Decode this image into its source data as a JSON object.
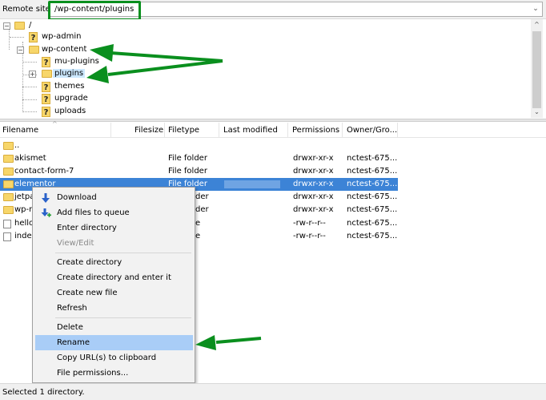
{
  "remote": {
    "label": "Remote site:",
    "path": "/wp-content/plugins",
    "dropdown_glyph": "⌄"
  },
  "tree": {
    "items": [
      {
        "label": "/",
        "icon": "folder-icon"
      },
      {
        "label": "wp-admin",
        "icon": "question-folder-icon"
      },
      {
        "label": "wp-content",
        "icon": "folder-icon"
      },
      {
        "label": "mu-plugins",
        "icon": "question-folder-icon"
      },
      {
        "label": "plugins",
        "icon": "folder-icon"
      },
      {
        "label": "themes",
        "icon": "question-folder-icon"
      },
      {
        "label": "upgrade",
        "icon": "question-folder-icon"
      },
      {
        "label": "uploads",
        "icon": "question-folder-icon"
      }
    ],
    "unknown_glyph": "?",
    "expander_open": "−",
    "expander_closed": "+",
    "scroll_up": "^",
    "scroll_down": "⌄"
  },
  "list": {
    "columns": [
      "Filename",
      "Filesize",
      "Filetype",
      "Last modified",
      "Permissions",
      "Owner/Gro..."
    ],
    "sort_caret": "^",
    "rows": [
      {
        "name": "..",
        "type": "",
        "perms": "",
        "owner": "",
        "icon": "folder-icon"
      },
      {
        "name": "akismet",
        "type": "File folder",
        "perms": "drwxr-xr-x",
        "owner": "nctest-675...",
        "icon": "folder-icon"
      },
      {
        "name": "contact-form-7",
        "type": "File folder",
        "perms": "drwxr-xr-x",
        "owner": "nctest-675...",
        "icon": "folder-icon"
      },
      {
        "name": "elementor",
        "type": "File folder",
        "perms": "drwxr-xr-x",
        "owner": "nctest-675...",
        "icon": "folder-icon",
        "selected": true
      },
      {
        "name": "jetpac",
        "type": "der",
        "perms": "drwxr-xr-x",
        "owner": "nctest-675...",
        "icon": "folder-icon"
      },
      {
        "name": "wp-m",
        "type": "der",
        "perms": "drwxr-xr-x",
        "owner": "nctest-675...",
        "icon": "folder-icon"
      },
      {
        "name": "hello.",
        "type": "e",
        "perms": "-rw-r--r--",
        "owner": "nctest-675...",
        "icon": "file-icon"
      },
      {
        "name": "index",
        "type": "e",
        "perms": "-rw-r--r--",
        "owner": "nctest-675...",
        "icon": "file-icon"
      }
    ]
  },
  "context_menu": {
    "items": [
      {
        "label": "Download",
        "icon": "download-arrow-icon"
      },
      {
        "label": "Add files to queue",
        "icon": "add-to-queue-icon"
      },
      {
        "label": "Enter directory"
      },
      {
        "label": "View/Edit",
        "disabled": true
      },
      {
        "label": "Create directory"
      },
      {
        "label": "Create directory and enter it"
      },
      {
        "label": "Create new file"
      },
      {
        "label": "Refresh"
      },
      {
        "label": "Delete"
      },
      {
        "label": "Rename",
        "highlighted": true
      },
      {
        "label": "Copy URL(s) to clipboard"
      },
      {
        "label": "File permissions..."
      }
    ]
  },
  "status": {
    "text": "Selected 1 directory."
  },
  "colors": {
    "selection": "#3c83d6",
    "menu_highlight": "#a9cdf7",
    "annotation_green": "#0a8f1e",
    "folder_yellow": "#f7d66a"
  }
}
